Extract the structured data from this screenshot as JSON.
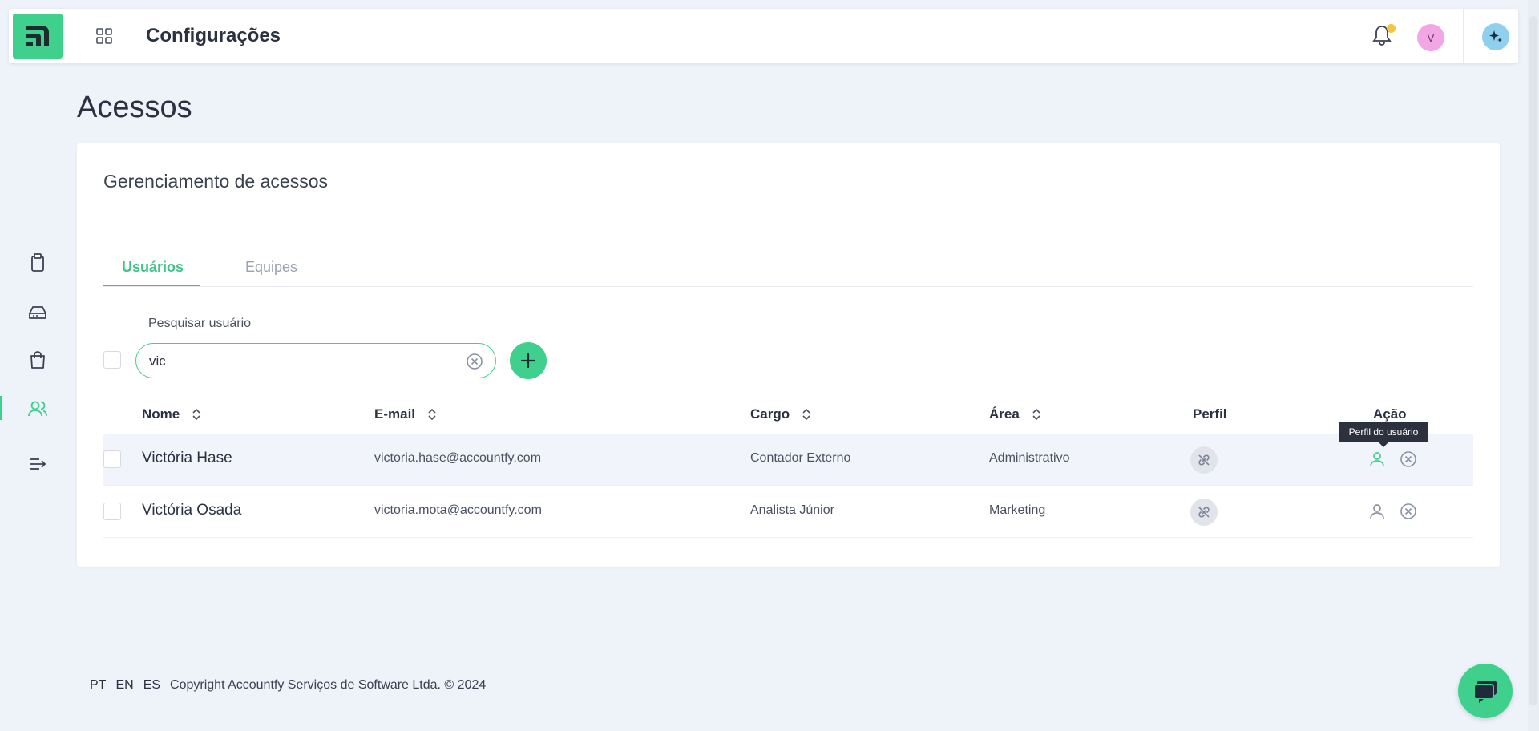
{
  "header": {
    "title": "Configurações",
    "avatar_initial": "V"
  },
  "page": {
    "title": "Acessos"
  },
  "card": {
    "title": "Gerenciamento de acessos",
    "tabs": [
      {
        "label": "Usuários",
        "active": true
      },
      {
        "label": "Equipes",
        "active": false
      }
    ],
    "search": {
      "label": "Pesquisar usuário",
      "value": "vic"
    },
    "table": {
      "columns": [
        "Nome",
        "E-mail",
        "Cargo",
        "Área",
        "Perfil",
        "Ação"
      ],
      "rows": [
        {
          "name": "Victória Hase",
          "email": "victoria.hase@accountfy.com",
          "cargo": "Contador Externo",
          "area": "Administrativo"
        },
        {
          "name": "Victória Osada",
          "email": "victoria.mota@accountfy.com",
          "cargo": "Analista Júnior",
          "area": "Marketing"
        }
      ],
      "tooltip": "Perfil do usuário"
    }
  },
  "footer": {
    "languages": [
      "PT",
      "EN",
      "ES"
    ],
    "copyright": "Copyright Accountfy Serviços de Software Ltda. © 2024"
  },
  "colors": {
    "accent": "#3fd08d",
    "background": "#eef2f9"
  }
}
